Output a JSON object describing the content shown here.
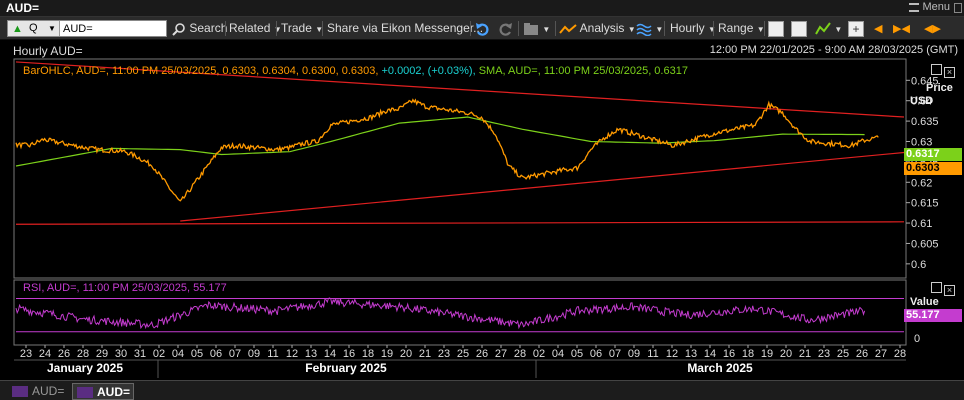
{
  "window": {
    "title": "AUD=",
    "menu_label": "Menu"
  },
  "toolbar": {
    "ric_prefix": "Q",
    "ric_value": "AUD=",
    "search_label": "Search",
    "related_label": "Related",
    "trade_label": "Trade",
    "share_label": "Share via Eikon Messenger...",
    "analysis_label": "Analysis",
    "interval_label": "Hourly",
    "range_label": "Range"
  },
  "chart_header": {
    "title": "Hourly AUD=",
    "date_range": "12:00 PM 22/01/2025 - 9:00 AM 28/03/2025 (GMT)"
  },
  "price_panel": {
    "legend_bar": "BarOHLC, AUD=, 11:00 PM 25/03/2025, 0.6303, 0.6304, 0.6300, 0.6303,",
    "legend_change": "+0.0002, (+0.03%),",
    "legend_sma": "SMA, AUD=, 11:00 PM 25/03/2025, 0.6317",
    "axis_title": "Price",
    "axis_unit": "USD",
    "sma_badge": "0.6317",
    "last_badge": "0.6303",
    "sma_badge_color": "#7cd11a",
    "last_badge_color": "#ff9a00"
  },
  "rsi_panel": {
    "legend": "RSI, AUD=, 11:00 PM 25/03/2025, 55.177",
    "axis_title": "Value",
    "badge": "55.177",
    "badge_color": "#c43ccf"
  },
  "bottom_tabs": [
    {
      "label": "AUD=",
      "active": false
    },
    {
      "label": "AUD=",
      "active": true
    }
  ],
  "colors": {
    "price_line": "#ff9a00",
    "sma_line": "#7cd11a",
    "trend_line": "#e02020",
    "rsi_line": "#c43ccf",
    "background": "#000000"
  },
  "chart_data": [
    {
      "type": "line",
      "title": "",
      "ylabel": "Price USD",
      "ylim": [
        0.598,
        0.649
      ],
      "yticks": [
        0.6,
        0.605,
        0.61,
        0.615,
        0.62,
        0.625,
        0.63,
        0.635,
        0.64,
        0.645
      ],
      "x_tick_labels": [
        "23",
        "24",
        "26",
        "28",
        "29",
        "30",
        "31",
        "02",
        "04",
        "05",
        "06",
        "07",
        "09",
        "11",
        "12",
        "13",
        "14",
        "16",
        "18",
        "19",
        "20",
        "21",
        "23",
        "25",
        "26",
        "27",
        "28",
        "02",
        "04",
        "05",
        "06",
        "07",
        "09",
        "11",
        "12",
        "13",
        "14",
        "16",
        "18",
        "19",
        "20",
        "21",
        "23",
        "25",
        "26",
        "27",
        "28"
      ],
      "months": [
        "January 2025",
        "February 2025",
        "March 2025"
      ],
      "series": [
        {
          "name": "BarOHLC, AUD=",
          "x": [
            "2025-01-22",
            "2025-01-23",
            "2025-01-24",
            "2025-01-27",
            "2025-01-28",
            "2025-01-29",
            "2025-01-30",
            "2025-01-31",
            "2025-02-01",
            "2025-02-03",
            "2025-02-04",
            "2025-02-05",
            "2025-02-06",
            "2025-02-07",
            "2025-02-10",
            "2025-02-11",
            "2025-02-12",
            "2025-02-13",
            "2025-02-14",
            "2025-02-17",
            "2025-02-18",
            "2025-02-19",
            "2025-02-20",
            "2025-02-21",
            "2025-02-24",
            "2025-02-25",
            "2025-02-26",
            "2025-02-27",
            "2025-02-28",
            "2025-03-03",
            "2025-03-04",
            "2025-03-05",
            "2025-03-06",
            "2025-03-07",
            "2025-03-10",
            "2025-03-11",
            "2025-03-12",
            "2025-03-13",
            "2025-03-14",
            "2025-03-17",
            "2025-03-18",
            "2025-03-19",
            "2025-03-20",
            "2025-03-21",
            "2025-03-24",
            "2025-03-25",
            "2025-03-26"
          ],
          "values": [
            0.6292,
            0.629,
            0.6305,
            0.6285,
            0.628,
            0.6278,
            0.6275,
            0.626,
            0.624,
            0.615,
            0.6195,
            0.624,
            0.6285,
            0.629,
            0.628,
            0.6285,
            0.6295,
            0.63,
            0.634,
            0.636,
            0.6375,
            0.638,
            0.64,
            0.6385,
            0.637,
            0.636,
            0.632,
            0.624,
            0.621,
            0.623,
            0.6235,
            0.628,
            0.631,
            0.633,
            0.63,
            0.629,
            0.63,
            0.631,
            0.632,
            0.634,
            0.639,
            0.637,
            0.633,
            0.63,
            0.629,
            0.6303,
            0.631
          ]
        },
        {
          "name": "SMA, AUD=",
          "x": [
            "2025-01-22",
            "2025-01-29",
            "2025-02-03",
            "2025-02-06",
            "2025-02-11",
            "2025-02-14",
            "2025-02-19",
            "2025-02-24",
            "2025-02-28",
            "2025-03-05",
            "2025-03-10",
            "2025-03-14",
            "2025-03-19",
            "2025-03-25"
          ],
          "values": [
            0.624,
            0.6283,
            0.628,
            0.6268,
            0.6275,
            0.63,
            0.6345,
            0.636,
            0.633,
            0.63,
            0.6296,
            0.6302,
            0.6318,
            0.6317
          ]
        },
        {
          "name": "Trend line upper",
          "x": [
            "2025-01-22",
            "2025-03-28"
          ],
          "values": [
            0.6495,
            0.636
          ]
        },
        {
          "name": "Trend line lower",
          "x": [
            "2025-02-03",
            "2025-03-28"
          ],
          "values": [
            0.6105,
            0.6273
          ]
        },
        {
          "name": "Horizontal line",
          "x": [
            "2025-01-22",
            "2025-03-28"
          ],
          "values": [
            0.6097,
            0.6103
          ]
        }
      ]
    },
    {
      "type": "line",
      "title": "",
      "ylabel": "Value",
      "ylim": [
        0,
        100
      ],
      "yticks": [
        0
      ],
      "series": [
        {
          "name": "RSI, AUD=",
          "x": [
            "2025-01-22",
            "2025-01-27",
            "2025-02-01",
            "2025-02-05",
            "2025-02-10",
            "2025-02-14",
            "2025-02-19",
            "2025-02-24",
            "2025-02-28",
            "2025-03-04",
            "2025-03-08",
            "2025-03-12",
            "2025-03-17",
            "2025-03-21",
            "2025-03-25"
          ],
          "values": [
            58,
            45,
            38,
            62,
            55,
            66,
            60,
            48,
            38,
            55,
            60,
            50,
            58,
            44,
            55.177
          ]
        }
      ]
    }
  ]
}
